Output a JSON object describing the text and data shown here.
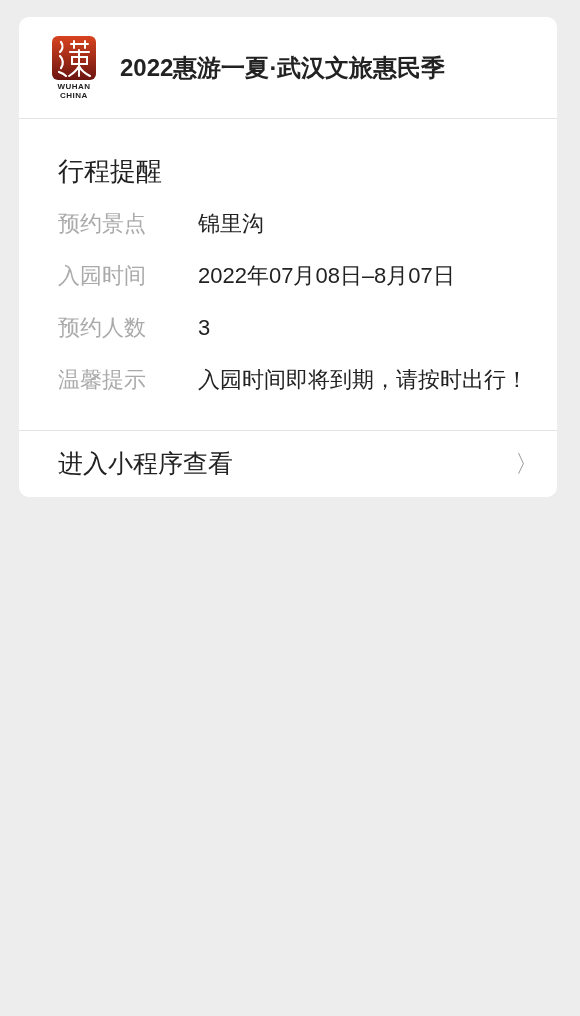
{
  "header": {
    "logo_text": [
      "WUHAN",
      "CHINA"
    ],
    "title": "2022惠游一夏·武汉文旅惠民季"
  },
  "section_title": "行程提醒",
  "details": [
    {
      "label": "预约景点",
      "value": "锦里沟"
    },
    {
      "label": "入园时间",
      "value": "2022年07月08日–8月07日"
    },
    {
      "label": "预约人数",
      "value": "3"
    },
    {
      "label": "温馨提示",
      "value": "入园时间即将到期，请按时出行！"
    }
  ],
  "footer": {
    "link": "进入小程序查看",
    "chevron": "〉"
  }
}
